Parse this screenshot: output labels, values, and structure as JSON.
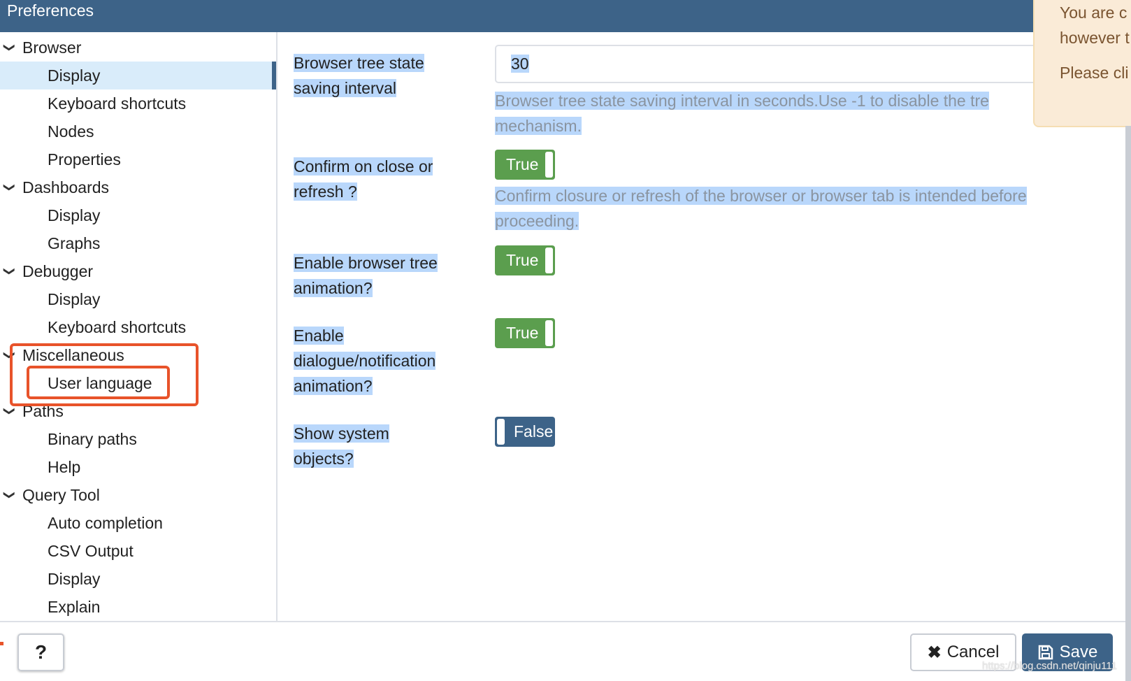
{
  "header": {
    "title": "Preferences"
  },
  "tree": [
    {
      "label": "Browser",
      "level": 0
    },
    {
      "label": "Display",
      "level": 1,
      "selected": true
    },
    {
      "label": "Keyboard shortcuts",
      "level": 1
    },
    {
      "label": "Nodes",
      "level": 1
    },
    {
      "label": "Properties",
      "level": 1
    },
    {
      "label": "Dashboards",
      "level": 0
    },
    {
      "label": "Display",
      "level": 1
    },
    {
      "label": "Graphs",
      "level": 1
    },
    {
      "label": "Debugger",
      "level": 0
    },
    {
      "label": "Display",
      "level": 1
    },
    {
      "label": "Keyboard shortcuts",
      "level": 1
    },
    {
      "label": "Miscellaneous",
      "level": 0
    },
    {
      "label": "User language",
      "level": 1
    },
    {
      "label": "Paths",
      "level": 0
    },
    {
      "label": "Binary paths",
      "level": 1
    },
    {
      "label": "Help",
      "level": 1
    },
    {
      "label": "Query Tool",
      "level": 0
    },
    {
      "label": "Auto completion",
      "level": 1
    },
    {
      "label": "CSV Output",
      "level": 1
    },
    {
      "label": "Display",
      "level": 1
    },
    {
      "label": "Explain",
      "level": 1
    }
  ],
  "settings": {
    "tree_state": {
      "label_1": "Browser tree state",
      "label_2": "saving interval",
      "value": "30",
      "help_1": "Browser tree state saving interval in seconds.Use -1 to disable the tre",
      "help_2": "mechanism."
    },
    "confirm_close": {
      "label_1": "Confirm on close or",
      "label_2": "refresh ?",
      "value": "True",
      "help_1": "Confirm closure or refresh of the browser or browser tab is intended before",
      "help_2": "proceeding."
    },
    "tree_animation": {
      "label_1": "Enable browser tree",
      "label_2": "animation?",
      "value": "True"
    },
    "dialog_animation": {
      "label_1": "Enable",
      "label_2": "dialogue/notification",
      "label_3": "animation?",
      "value": "True"
    },
    "system_objects": {
      "label_1": "Show system",
      "label_2": "objects?",
      "value": "False"
    }
  },
  "toast": {
    "line1": "You are c",
    "line2": "however t",
    "line3": "Please cli"
  },
  "footer": {
    "help": "?",
    "cancel": "Cancel",
    "save": "Save",
    "watermark": "https://blog.csdn.net/qinju111"
  },
  "colors": {
    "header": "#3d6388",
    "toggle_on": "#5b9e4e",
    "toggle_off": "#3d6388",
    "highlight": "#e8532a",
    "selection": "#b9d7fb"
  }
}
